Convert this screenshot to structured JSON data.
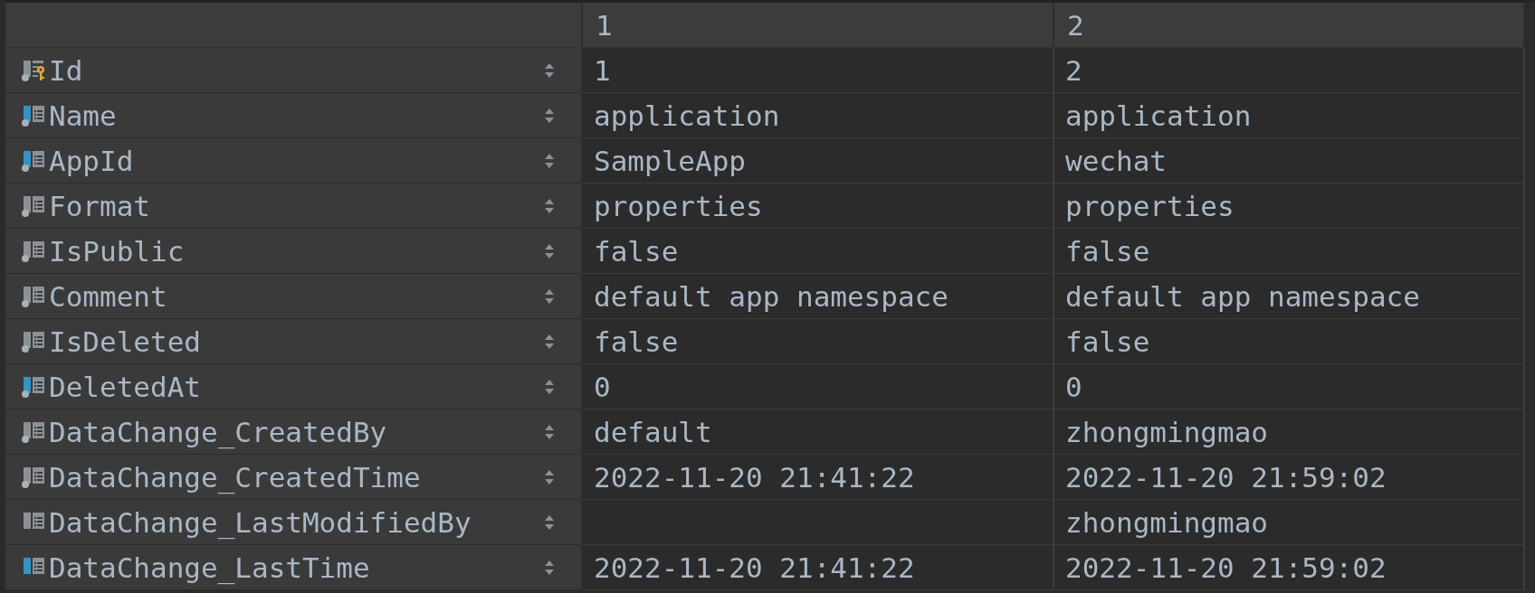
{
  "table": {
    "columns": [
      "1",
      "2"
    ],
    "rows": [
      {
        "field": "Id",
        "kind": "key",
        "indexed": false,
        "not_null": true,
        "cells": [
          {
            "text": "1"
          },
          {
            "text": "2"
          }
        ]
      },
      {
        "field": "Name",
        "kind": "column",
        "indexed": true,
        "not_null": true,
        "cells": [
          {
            "text": "application"
          },
          {
            "text": "application"
          }
        ]
      },
      {
        "field": "AppId",
        "kind": "column",
        "indexed": true,
        "not_null": true,
        "cells": [
          {
            "text": "SampleApp"
          },
          {
            "text": "wechat"
          }
        ]
      },
      {
        "field": "Format",
        "kind": "column",
        "indexed": false,
        "not_null": true,
        "cells": [
          {
            "text": "properties"
          },
          {
            "text": "properties"
          }
        ]
      },
      {
        "field": "IsPublic",
        "kind": "column",
        "indexed": false,
        "not_null": true,
        "cells": [
          {
            "text": "false"
          },
          {
            "text": "false"
          }
        ]
      },
      {
        "field": "Comment",
        "kind": "column",
        "indexed": false,
        "not_null": true,
        "cells": [
          {
            "text": "default app namespace"
          },
          {
            "text": "default app namespace"
          }
        ]
      },
      {
        "field": "IsDeleted",
        "kind": "column",
        "indexed": false,
        "not_null": true,
        "cells": [
          {
            "text": "false"
          },
          {
            "text": "false"
          }
        ]
      },
      {
        "field": "DeletedAt",
        "kind": "column",
        "indexed": true,
        "not_null": true,
        "cells": [
          {
            "text": "0"
          },
          {
            "text": "0"
          }
        ]
      },
      {
        "field": "DataChange_CreatedBy",
        "kind": "column",
        "indexed": false,
        "not_null": true,
        "cells": [
          {
            "text": "default"
          },
          {
            "text": "zhongmingmao"
          }
        ]
      },
      {
        "field": "DataChange_CreatedTime",
        "kind": "column",
        "indexed": false,
        "not_null": true,
        "cells": [
          {
            "text": "2022-11-20 21:41:22"
          },
          {
            "text": "2022-11-20 21:59:02"
          }
        ]
      },
      {
        "field": "DataChange_LastModifiedBy",
        "kind": "column",
        "indexed": false,
        "not_null": false,
        "cells": [
          {},
          {
            "text": "zhongmingmao"
          }
        ]
      },
      {
        "field": "DataChange_LastTime",
        "kind": "column",
        "indexed": true,
        "not_null": false,
        "cells": [
          {
            "text": "2022-11-20 21:41:22"
          },
          {
            "text": "2022-11-20 21:59:02"
          }
        ]
      }
    ]
  }
}
